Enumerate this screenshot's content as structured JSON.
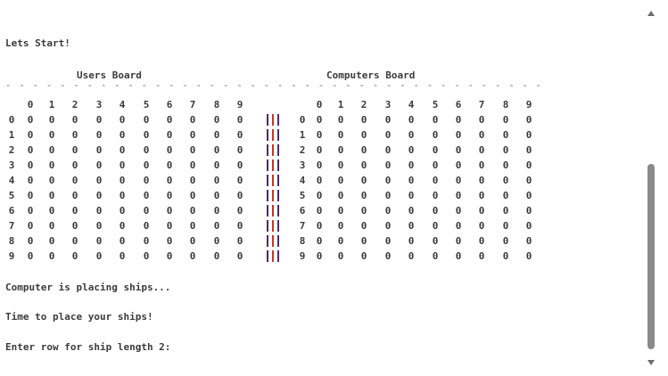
{
  "console": {
    "start_message": "Lets Start!",
    "player_board_title": "Users Board",
    "computer_board_title": "Computers Board",
    "divider": "- - - - - - - - - - - - - - - - - - - - - - - - - - - - - - - - - - - - - - - - - - - - - - - - - - - - - - - - - - - - - - - - - - - - - - - - - - - - - - - -",
    "column_headers": [
      "0",
      "1",
      "2",
      "3",
      "4",
      "5",
      "6",
      "7",
      "8",
      "9"
    ],
    "row_labels": [
      "0",
      "1",
      "2",
      "3",
      "4",
      "5",
      "6",
      "7",
      "8",
      "9"
    ],
    "player_cells": [
      [
        "0",
        "0",
        "0",
        "0",
        "0",
        "0",
        "0",
        "0",
        "0",
        "0"
      ],
      [
        "0",
        "0",
        "0",
        "0",
        "0",
        "0",
        "0",
        "0",
        "0",
        "0"
      ],
      [
        "0",
        "0",
        "0",
        "0",
        "0",
        "0",
        "0",
        "0",
        "0",
        "0"
      ],
      [
        "0",
        "0",
        "0",
        "0",
        "0",
        "0",
        "0",
        "0",
        "0",
        "0"
      ],
      [
        "0",
        "0",
        "0",
        "0",
        "0",
        "0",
        "0",
        "0",
        "0",
        "0"
      ],
      [
        "0",
        "0",
        "0",
        "0",
        "0",
        "0",
        "0",
        "0",
        "0",
        "0"
      ],
      [
        "0",
        "0",
        "0",
        "0",
        "0",
        "0",
        "0",
        "0",
        "0",
        "0"
      ],
      [
        "0",
        "0",
        "0",
        "0",
        "0",
        "0",
        "0",
        "0",
        "0",
        "0"
      ],
      [
        "0",
        "0",
        "0",
        "0",
        "0",
        "0",
        "0",
        "0",
        "0",
        "0"
      ],
      [
        "0",
        "0",
        "0",
        "0",
        "0",
        "0",
        "0",
        "0",
        "0",
        "0"
      ]
    ],
    "computer_cells": [
      [
        "0",
        "0",
        "0",
        "0",
        "0",
        "0",
        "0",
        "0",
        "0",
        "0"
      ],
      [
        "0",
        "0",
        "0",
        "0",
        "0",
        "0",
        "0",
        "0",
        "0",
        "0"
      ],
      [
        "0",
        "0",
        "0",
        "0",
        "0",
        "0",
        "0",
        "0",
        "0",
        "0"
      ],
      [
        "0",
        "0",
        "0",
        "0",
        "0",
        "0",
        "0",
        "0",
        "0",
        "0"
      ],
      [
        "0",
        "0",
        "0",
        "0",
        "0",
        "0",
        "0",
        "0",
        "0",
        "0"
      ],
      [
        "0",
        "0",
        "0",
        "0",
        "0",
        "0",
        "0",
        "0",
        "0",
        "0"
      ],
      [
        "0",
        "0",
        "0",
        "0",
        "0",
        "0",
        "0",
        "0",
        "0",
        "0"
      ],
      [
        "0",
        "0",
        "0",
        "0",
        "0",
        "0",
        "0",
        "0",
        "0",
        "0"
      ],
      [
        "0",
        "0",
        "0",
        "0",
        "0",
        "0",
        "0",
        "0",
        "0",
        "0"
      ],
      [
        "0",
        "0",
        "0",
        "0",
        "0",
        "0",
        "0",
        "0",
        "0",
        "0"
      ]
    ],
    "status_computer_placing": "Computer is placing ships...",
    "status_your_turn": "Time to place your ships!",
    "prompt_ship": "Enter row for ship length 2:"
  },
  "colors": {
    "text": "#3b3b3b",
    "separator_red": "#c0392b",
    "separator_dark": "#4a2b6b",
    "scrollbar_thumb": "#8a8a8a"
  }
}
